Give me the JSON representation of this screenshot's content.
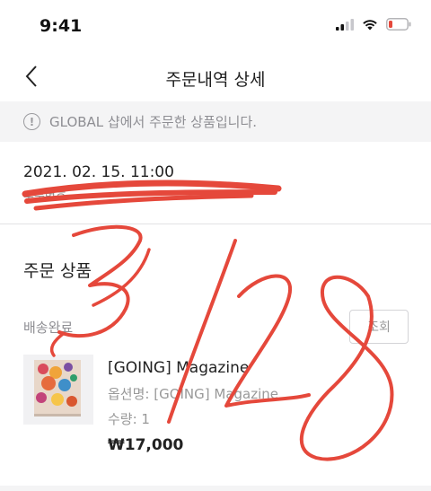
{
  "status_bar": {
    "time": "9:41",
    "icons": [
      "cellular-signal-icon",
      "wifi-icon",
      "battery-low-icon"
    ],
    "battery_color": "#e5483b"
  },
  "nav": {
    "title": "주문내역 상세",
    "back_icon": "chevron-left-icon"
  },
  "notice": {
    "icon": "info-circle-icon",
    "text": "GLOBAL 샵에서 주문한 상품입니다."
  },
  "order": {
    "date": "2021. 02. 15. 11:00",
    "number": "주문번호"
  },
  "products_section": {
    "title": "주문 상품",
    "shipping_status": "배송완료",
    "lookup_button": "조회",
    "items": [
      {
        "name": "[GOING] Magazine",
        "option": "옵션명: [GOING] Magazine",
        "quantity": "수량: 1",
        "price": "₩17,000"
      }
    ]
  },
  "annotation": {
    "handwritten_text": "3/28",
    "color": "#e5483b"
  },
  "colors": {
    "accent_red": "#e5483b",
    "notice_bg": "#f4f4f5",
    "muted_text": "#8e8e93"
  }
}
